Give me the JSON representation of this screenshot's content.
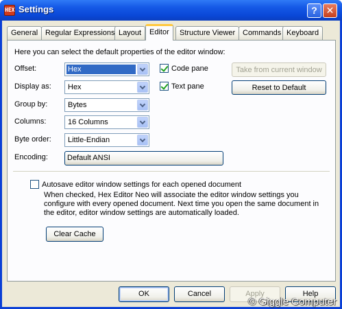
{
  "window": {
    "title": "Settings",
    "icon_text": "HEX",
    "help_glyph": "?",
    "close_glyph": "✕"
  },
  "tabs": [
    {
      "label": "General"
    },
    {
      "label": "Regular Expressions"
    },
    {
      "label": "Layout"
    },
    {
      "label": "Editor",
      "active": true
    },
    {
      "label": "Structure Viewer"
    },
    {
      "label": "Commands"
    },
    {
      "label": "Keyboard"
    }
  ],
  "editor": {
    "intro": "Here you can select the default properties of the editor window:",
    "offset": {
      "label": "Offset:",
      "value": "Hex"
    },
    "display_as": {
      "label": "Display as:",
      "value": "Hex"
    },
    "group_by": {
      "label": "Group by:",
      "value": "Bytes"
    },
    "columns": {
      "label": "Columns:",
      "value": "16 Columns"
    },
    "byte_order": {
      "label": "Byte order:",
      "value": "Little-Endian"
    },
    "encoding": {
      "label": "Encoding:",
      "value": "Default ANSI"
    },
    "code_pane": {
      "label": "Code pane",
      "checked": true
    },
    "text_pane": {
      "label": "Text pane",
      "checked": true
    },
    "take_from_current": "Take from current window",
    "reset_default": "Reset to Default",
    "autosave": {
      "label": "Autosave editor window settings for each opened document",
      "checked": false
    },
    "autosave_desc": "When checked, Hex Editor Neo will associate the editor window settings you configure with every opened document. Next time you open the same document in the editor, editor window settings are automatically loaded.",
    "clear_cache": "Clear Cache"
  },
  "footer": {
    "ok": "OK",
    "cancel": "Cancel",
    "apply": "Apply",
    "help": "Help"
  },
  "watermark": "© Giggle Computer"
}
